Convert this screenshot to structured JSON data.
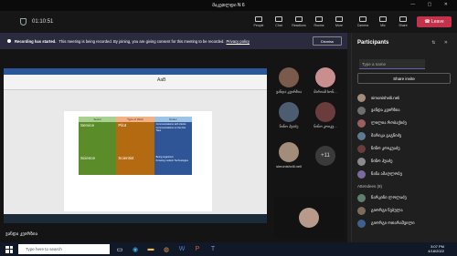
{
  "window": {
    "title": "მაკეთლდი N 6"
  },
  "meeting": {
    "timer": "01:10:51",
    "tools": [
      "People",
      "Chat",
      "Reactions",
      "Rooms",
      "More"
    ],
    "tools2": [
      "Camera",
      "Mic",
      "Share"
    ],
    "leave_label": "Leave"
  },
  "banner": {
    "bold": "Recording has started.",
    "text": "This meeting is being recorded. By joining, you are giving consent for this meeting to be recorded.",
    "link": "Privacy policy",
    "dismiss": "Dismiss"
  },
  "doc_table": {
    "headers": [
      "Sector",
      "Type of Work",
      "Duties"
    ],
    "rows": [
      [
        "Service",
        "Pilot",
        ""
      ],
      [
        "",
        "",
        ""
      ],
      [
        "Science",
        "Scientist",
        ""
      ]
    ],
    "bullets_row1": [
      "Communications with clients",
      "Communications on the Fire Taos"
    ],
    "bullets_row3": [
      "Being organized",
      "Knowing modern Technologies"
    ]
  },
  "tiles": [
    {
      "name": "ვანდა კვირზია",
      "color": "#7a5a4a"
    },
    {
      "name": "მარიამ ხონ...",
      "color": "#c98f8f"
    },
    {
      "name": "ნინო ჰუაძე",
      "color": "#4b5d6f"
    },
    {
      "name": "ნინო კოიკუ...",
      "color": "#6a3c3c"
    },
    {
      "name": "simonishvili.neli",
      "color": "#a28c7a"
    },
    {
      "name": "+11",
      "color": "#3a3a3a"
    }
  ],
  "speaker": {
    "name": "ვანდა კვირზია"
  },
  "panel": {
    "title": "Participants",
    "type_name_placeholder": "Type a name",
    "share_invite": "Share invite",
    "attendees_label": "Attendees (8)",
    "participants": [
      {
        "name": "simonishvili.neli",
        "color": "#a28c7a"
      },
      {
        "name": "ვანდა კვირზია",
        "color": "#6f6f6f"
      },
      {
        "name": "ლილია რობაქიძე",
        "color": "#9c5f5f"
      },
      {
        "name": "მარიკა გაგნიძე",
        "color": "#5e7a92"
      },
      {
        "name": "ნინო კოიკუაძე",
        "color": "#6a3c3c"
      },
      {
        "name": "ნინო ჰუაძე",
        "color": "#8b8b8b"
      },
      {
        "name": "ნანა ამაღლობე",
        "color": "#7c6a9a"
      }
    ],
    "attendees": [
      {
        "name": "ნარკიჩი ლოლაძე",
        "color": "#5f7f6f"
      },
      {
        "name": "გიორგი ნებულა",
        "color": "#7d6c57"
      },
      {
        "name": "გიორგი ოთარაშვილი",
        "color": "#3f5f8f"
      }
    ]
  },
  "taskbar": {
    "search_placeholder": "Type here to search",
    "time": "3:07 PM",
    "date": "4/18/2022"
  }
}
